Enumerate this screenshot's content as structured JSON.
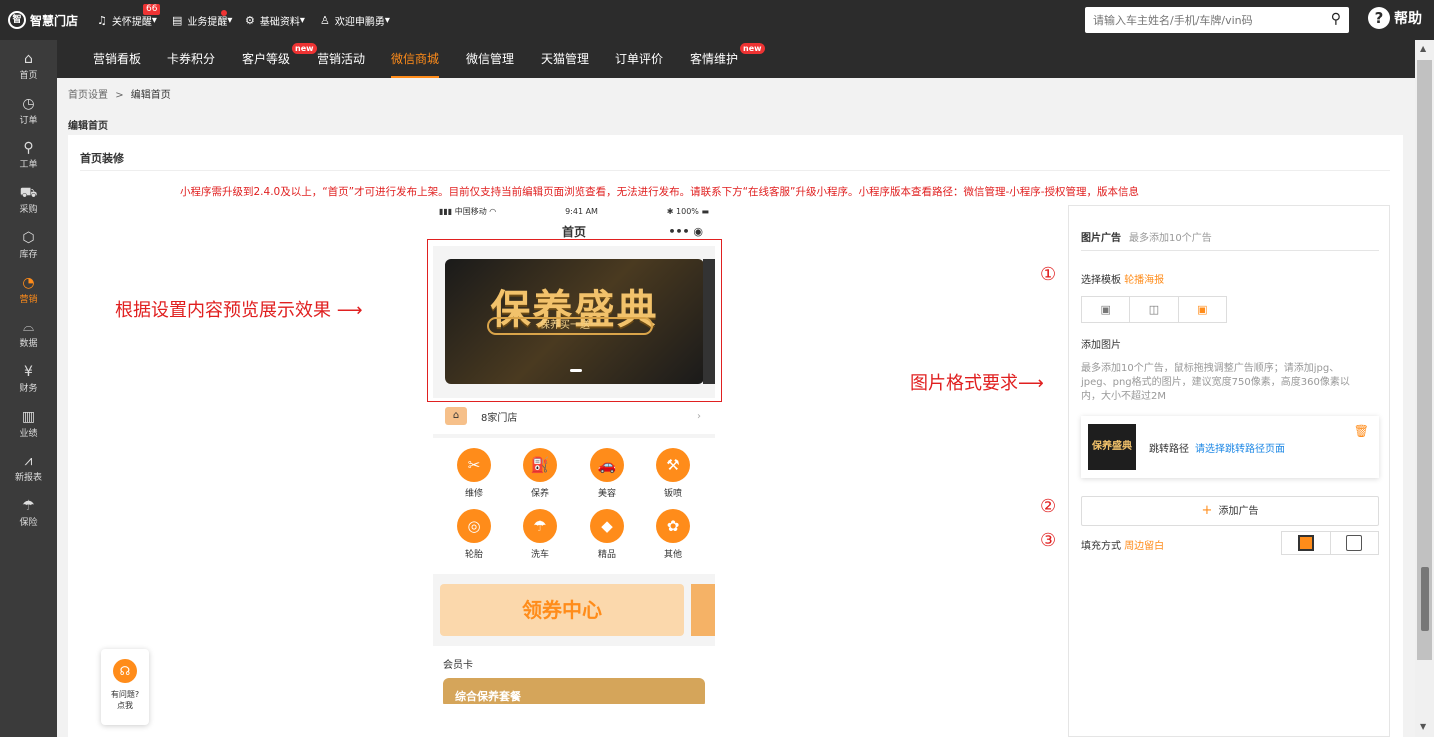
{
  "topbar": {
    "logo": "智慧门店",
    "alerts_label": "关怀提醒",
    "alerts_badge": "66",
    "business_label": "业务提醒",
    "base_label": "基础资料",
    "welcome_label": "欢迎申鹏勇",
    "search_placeholder": "请输入车主姓名/手机/车牌/vin码",
    "help_label": "帮助"
  },
  "sidebar": {
    "items": [
      {
        "icon": "⌂",
        "label": "首页"
      },
      {
        "icon": "◷",
        "label": "订单"
      },
      {
        "icon": "⚲",
        "label": "工单"
      },
      {
        "icon": "⛟",
        "label": "采购"
      },
      {
        "icon": "⬡",
        "label": "库存"
      },
      {
        "icon": "◔",
        "label": "营销"
      },
      {
        "icon": "⌓",
        "label": "数据"
      },
      {
        "icon": "¥",
        "label": "财务"
      },
      {
        "icon": "▥",
        "label": "业绩"
      },
      {
        "icon": "⩘",
        "label": "新报表"
      },
      {
        "icon": "☂",
        "label": "保险"
      }
    ],
    "active": 5
  },
  "menu": {
    "items": [
      {
        "label": "营销看板"
      },
      {
        "label": "卡券积分"
      },
      {
        "label": "客户等级",
        "new": "new"
      },
      {
        "label": "营销活动"
      },
      {
        "label": "微信商城"
      },
      {
        "label": "微信管理"
      },
      {
        "label": "天猫管理"
      },
      {
        "label": "订单评价"
      },
      {
        "label": "客情维护",
        "new": "new"
      }
    ],
    "active": 4
  },
  "breadcrumb": {
    "parent": "首页设置",
    "sep": ">",
    "current": "编辑首页"
  },
  "page_header": "编辑首页",
  "section_title": "首页装修",
  "notice": "小程序需升级到2.4.0及以上，“首页”才可进行发布上架。目前仅支持当前编辑页面浏览查看，无法进行发布。请联系下方“在线客服”升级小程序。小程序版本查看路径：微信管理-小程序-授权管理，版本信息",
  "annotations": {
    "preview": "根据设置内容预览展示效果",
    "format": "图片格式要求",
    "n1": "①",
    "n2": "②",
    "n3": "③"
  },
  "phone": {
    "carrier": "中国移动",
    "time": "9:41 AM",
    "battery": "100%",
    "title": "首页",
    "banner_title": "保养盛典",
    "banner_sub": "保养买一送一",
    "store": "8家门店",
    "grid": [
      {
        "icon": "✂",
        "label": "维修"
      },
      {
        "icon": "⛽",
        "label": "保养"
      },
      {
        "icon": "🚗",
        "label": "美容"
      },
      {
        "icon": "⚒",
        "label": "钣喷"
      },
      {
        "icon": "◎",
        "label": "轮胎"
      },
      {
        "icon": "☂",
        "label": "洗车"
      },
      {
        "icon": "◆",
        "label": "精品"
      },
      {
        "icon": "✿",
        "label": "其他"
      }
    ],
    "coupon": "领券中心",
    "member_label": "会员卡",
    "member_card": "综合保养套餐"
  },
  "panel": {
    "title": "图片广告",
    "title_hint": "最多添加10个广告",
    "template_label": "选择模板",
    "template_value": "轮播海报",
    "add_image_label": "添加图片",
    "desc": "最多添加10个广告，鼠标拖拽调整广告顺序；请添加jpg、jpeg、png格式的图片，建议宽度750像素，高度360像素以内，大小不超过2M",
    "ad_thumb": "保养盛典",
    "jump_label": "跳转路径",
    "jump_link": "请选择跳转路径页面",
    "add_button": "添加广告",
    "fill_label": "填充方式",
    "fill_value": "周边留白"
  },
  "help_box": {
    "line1": "有问题?",
    "line2": "点我"
  }
}
